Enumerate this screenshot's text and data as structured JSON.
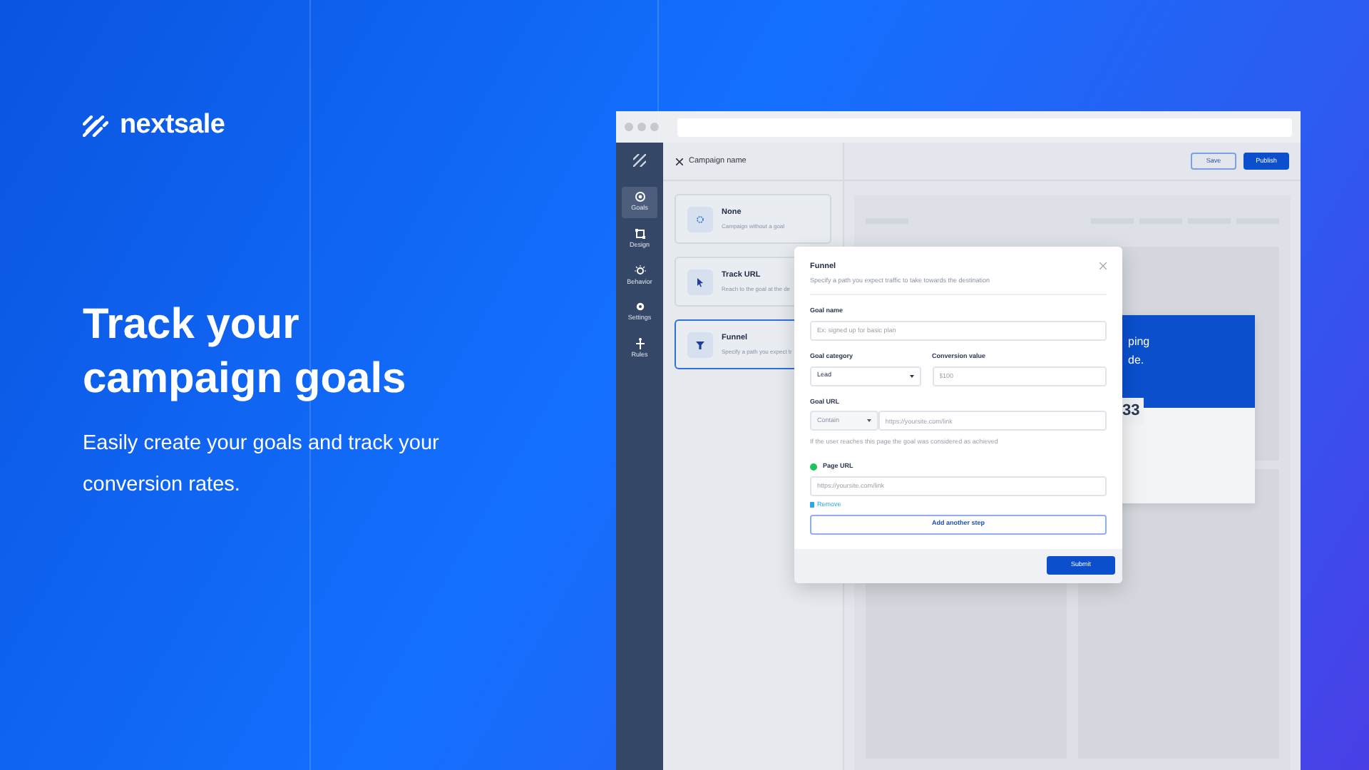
{
  "brand": {
    "name": "nextsale"
  },
  "hero": {
    "title": "Track your campaign goals",
    "subtitle": "Easily create your goals and track your conversion rates."
  },
  "app": {
    "sidebar": {
      "items": [
        {
          "label": "Goals",
          "selected": true
        },
        {
          "label": "Design",
          "selected": false
        },
        {
          "label": "Behavior",
          "selected": false
        },
        {
          "label": "Settings",
          "selected": false
        },
        {
          "label": "Rules",
          "selected": false
        }
      ]
    },
    "header": {
      "title": "Campaign name"
    },
    "goal_options": [
      {
        "title": "None",
        "description": "Campaign without a goal",
        "selected": false
      },
      {
        "title": "Track URL",
        "description": "Reach to the goal at the de",
        "selected": false
      },
      {
        "title": "Funnel",
        "description": "Specify a path you expect tr",
        "selected": true
      }
    ],
    "toolbar": {
      "buttons": [
        "Save",
        "Publish"
      ]
    },
    "preview": {
      "heading_lines": [
        "ping",
        "de."
      ],
      "counter": "33"
    },
    "modal": {
      "title": "Funnel",
      "subtitle": "Specify a path you expect traffic to take towards the destination",
      "goal_name": {
        "label": "Goal name",
        "placeholder": "Ex: signed up for basic plan"
      },
      "goal_category": {
        "label": "Goal category",
        "value": "Lead"
      },
      "conversion_value": {
        "label": "Conversion value",
        "placeholder": "$100"
      },
      "goal_url": {
        "label": "Goal URL",
        "match": "Contain",
        "placeholder": "https://yoursite.com/link",
        "help": "If the user reaches this page the goal was considered as achieved"
      },
      "steps": [
        {
          "label": "Page URL",
          "placeholder": "https://yoursite.com/link"
        }
      ],
      "remove": "Remove",
      "add_step": "Add another step",
      "submit": "Submit"
    }
  }
}
